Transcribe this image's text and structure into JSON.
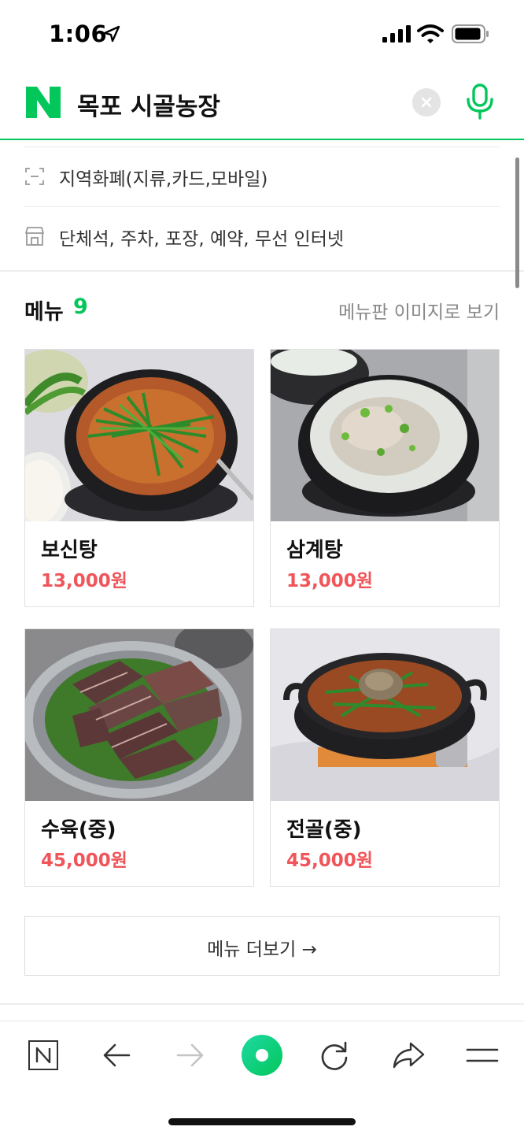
{
  "status_bar": {
    "time": "1:06"
  },
  "header": {
    "query": "목포 시골농장"
  },
  "info": {
    "payment": "지역화폐(지류,카드,모바일)",
    "facilities": "단체석, 주차, 포장, 예약, 무선 인터넷"
  },
  "menu": {
    "title": "메뉴",
    "count": "9",
    "image_link": "메뉴판 이미지로 보기",
    "items": [
      {
        "name": "보신탕",
        "price": "13,000원"
      },
      {
        "name": "삼계탕",
        "price": "13,000원"
      },
      {
        "name": "수육(중)",
        "price": "45,000원"
      },
      {
        "name": "전골(중)",
        "price": "45,000원"
      }
    ],
    "more": "메뉴 더보기 →"
  },
  "colors": {
    "brand": "#03c75a",
    "price": "#f0555a"
  },
  "icons": [
    "location-arrow-icon",
    "signal-icon",
    "wifi-icon",
    "battery-icon",
    "naver-logo",
    "clear-icon",
    "mic-icon",
    "currency-icon",
    "store-icon",
    "naver-home-icon",
    "back-arrow-icon",
    "forward-arrow-icon",
    "green-dot-icon",
    "reload-icon",
    "share-icon",
    "hamburger-menu-icon"
  ]
}
